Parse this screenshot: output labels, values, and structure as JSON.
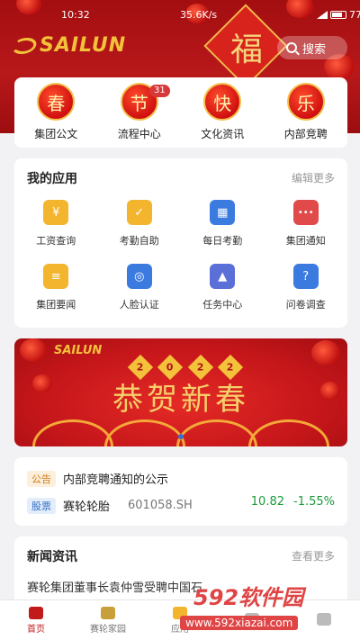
{
  "status_bar": {
    "time": "10:32",
    "network": "35.6K/s",
    "battery": "77"
  },
  "header": {
    "logo_text": "SAILUN",
    "fu_char": "福",
    "search_label": "搜索"
  },
  "quick": [
    {
      "badge": "春",
      "label": "集团公文",
      "count": ""
    },
    {
      "badge": "节",
      "label": "流程中心",
      "count": "31"
    },
    {
      "badge": "快",
      "label": "文化资讯",
      "count": ""
    },
    {
      "badge": "乐",
      "label": "内部竞聘",
      "count": ""
    }
  ],
  "apps": {
    "title": "我的应用",
    "more": "编辑更多",
    "items": [
      {
        "label": "工资查询",
        "icon": "yen-icon",
        "color": "#f3b52e",
        "glyph": "¥"
      },
      {
        "label": "考勤自助",
        "icon": "check-briefcase-icon",
        "color": "#f3b52e",
        "glyph": "✓"
      },
      {
        "label": "每日考勤",
        "icon": "calendar-icon",
        "color": "#3b7be0",
        "glyph": "▦"
      },
      {
        "label": "集团通知",
        "icon": "message-icon",
        "color": "#e04a4a",
        "glyph": "•••"
      },
      {
        "label": "集团要闻",
        "icon": "document-icon",
        "color": "#f3b52e",
        "glyph": "≡"
      },
      {
        "label": "人脸认证",
        "icon": "face-scan-icon",
        "color": "#3b7be0",
        "glyph": "◎"
      },
      {
        "label": "任务中心",
        "icon": "stamp-icon",
        "color": "#5b6fd8",
        "glyph": "▲"
      },
      {
        "label": "问卷调查",
        "icon": "survey-icon",
        "color": "#3b7be0",
        "glyph": "?"
      }
    ]
  },
  "banner": {
    "logo": "SAILUN",
    "year": [
      "2",
      "0",
      "2",
      "2"
    ],
    "title": "恭贺新春"
  },
  "notice": {
    "tag": "公告",
    "text": "内部竞聘通知的公示"
  },
  "stock": {
    "tag": "股票",
    "name": "赛轮轮胎",
    "code": "601058.SH",
    "price": "10.82",
    "change": "-1.55%"
  },
  "news": {
    "title": "新闻资讯",
    "more": "查看更多",
    "first_item": "赛轮集团董事长袁仲雪受聘中国石"
  },
  "nav": [
    {
      "label": "首页",
      "active": true
    },
    {
      "label": "赛轮家园",
      "active": false
    },
    {
      "label": "应用",
      "active": false
    },
    {
      "label": "",
      "active": false
    },
    {
      "label": "",
      "active": false
    }
  ],
  "watermark": {
    "brand": "592软件园",
    "url": "www.592xiazai.com"
  },
  "colors": {
    "primary_red": "#b8181a",
    "gold": "#f3c23a",
    "stock_green": "#1b9a3a"
  }
}
